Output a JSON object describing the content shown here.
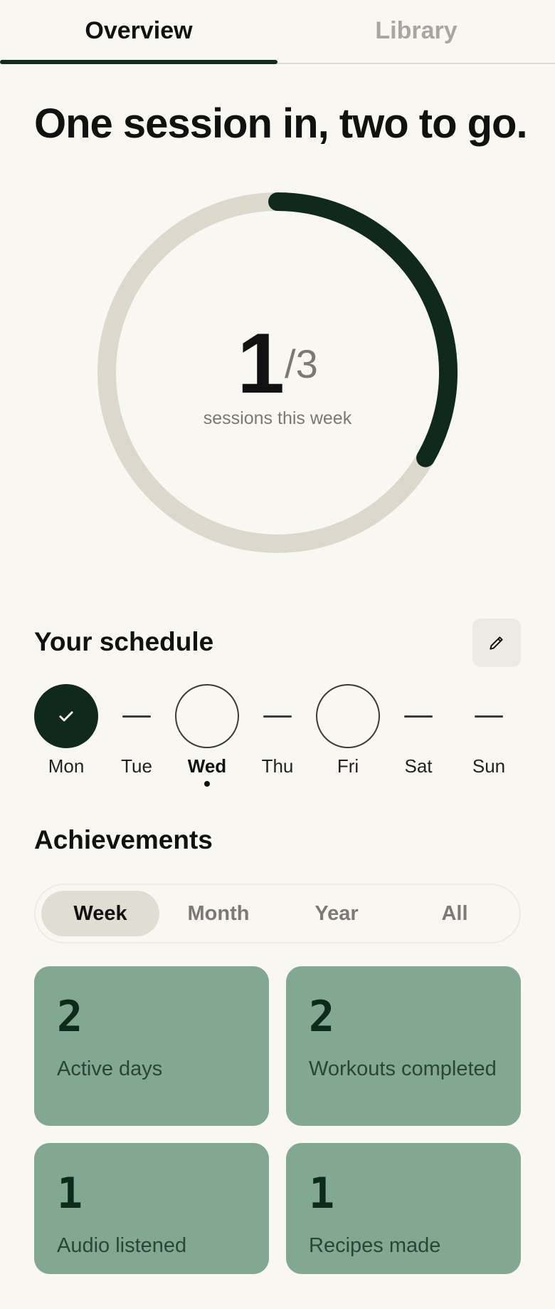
{
  "tabs": [
    {
      "label": "Overview",
      "active": true
    },
    {
      "label": "Library",
      "active": false
    }
  ],
  "headline": "One session in, two to go.",
  "progress": {
    "completed": "1",
    "total": "/3",
    "caption": "sessions this week",
    "fraction": 0.333,
    "track_color": "#dcd9cc",
    "fill_color": "#0f2a1c"
  },
  "schedule": {
    "title": "Your schedule",
    "edit_icon": "pencil-icon",
    "days": [
      {
        "label": "Mon",
        "state": "done"
      },
      {
        "label": "Tue",
        "state": "rest"
      },
      {
        "label": "Wed",
        "state": "planned",
        "today": true
      },
      {
        "label": "Thu",
        "state": "rest"
      },
      {
        "label": "Fri",
        "state": "planned"
      },
      {
        "label": "Sat",
        "state": "rest"
      },
      {
        "label": "Sun",
        "state": "rest"
      }
    ]
  },
  "achievements": {
    "title": "Achievements",
    "periods": [
      "Week",
      "Month",
      "Year",
      "All"
    ],
    "selected_period": "Week",
    "cards": [
      {
        "value": "2",
        "label": "Active days"
      },
      {
        "value": "2",
        "label": "Workouts completed"
      },
      {
        "value": "1",
        "label": "Audio listened"
      },
      {
        "value": "1",
        "label": "Recipes made"
      }
    ],
    "card_color": "#83a891"
  }
}
